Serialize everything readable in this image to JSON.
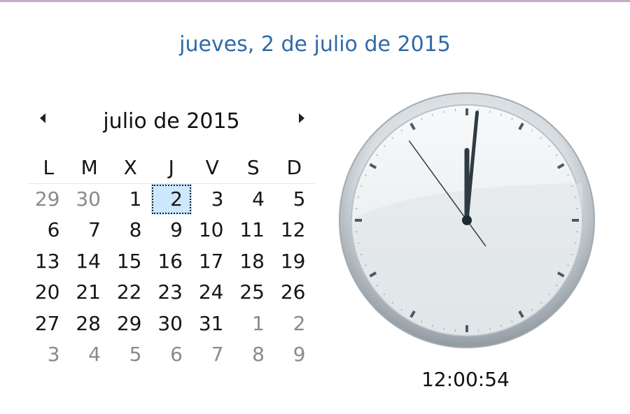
{
  "header": {
    "long_date": "jueves, 2 de julio de 2015"
  },
  "calendar": {
    "prev_icon": "triangle-left-icon",
    "next_icon": "triangle-right-icon",
    "month_label": "julio de 2015",
    "weekdays": [
      "L",
      "M",
      "X",
      "J",
      "V",
      "S",
      "D"
    ],
    "weeks": [
      [
        {
          "d": "29",
          "o": true
        },
        {
          "d": "30",
          "o": true
        },
        {
          "d": "1"
        },
        {
          "d": "2",
          "today": true
        },
        {
          "d": "3"
        },
        {
          "d": "4"
        },
        {
          "d": "5"
        }
      ],
      [
        {
          "d": "6"
        },
        {
          "d": "7"
        },
        {
          "d": "8"
        },
        {
          "d": "9"
        },
        {
          "d": "10"
        },
        {
          "d": "11"
        },
        {
          "d": "12"
        }
      ],
      [
        {
          "d": "13"
        },
        {
          "d": "14"
        },
        {
          "d": "15"
        },
        {
          "d": "16"
        },
        {
          "d": "17"
        },
        {
          "d": "18"
        },
        {
          "d": "19"
        }
      ],
      [
        {
          "d": "20"
        },
        {
          "d": "21"
        },
        {
          "d": "22"
        },
        {
          "d": "23"
        },
        {
          "d": "24"
        },
        {
          "d": "25"
        },
        {
          "d": "26"
        }
      ],
      [
        {
          "d": "27"
        },
        {
          "d": "28"
        },
        {
          "d": "29"
        },
        {
          "d": "30"
        },
        {
          "d": "31"
        },
        {
          "d": "1",
          "o": true
        },
        {
          "d": "2",
          "o": true
        }
      ],
      [
        {
          "d": "3",
          "o": true
        },
        {
          "d": "4",
          "o": true
        },
        {
          "d": "5",
          "o": true
        },
        {
          "d": "6",
          "o": true
        },
        {
          "d": "7",
          "o": true
        },
        {
          "d": "8",
          "o": true
        },
        {
          "d": "9",
          "o": true
        }
      ]
    ]
  },
  "clock": {
    "hours": 12,
    "minutes": 0,
    "seconds": 54,
    "digital_time": "12:00:54",
    "colors": {
      "face": "#eef1f3",
      "rim": "#9ea7ae",
      "hands": "#2e3b44",
      "second_hand": "#3a3a3a"
    }
  }
}
